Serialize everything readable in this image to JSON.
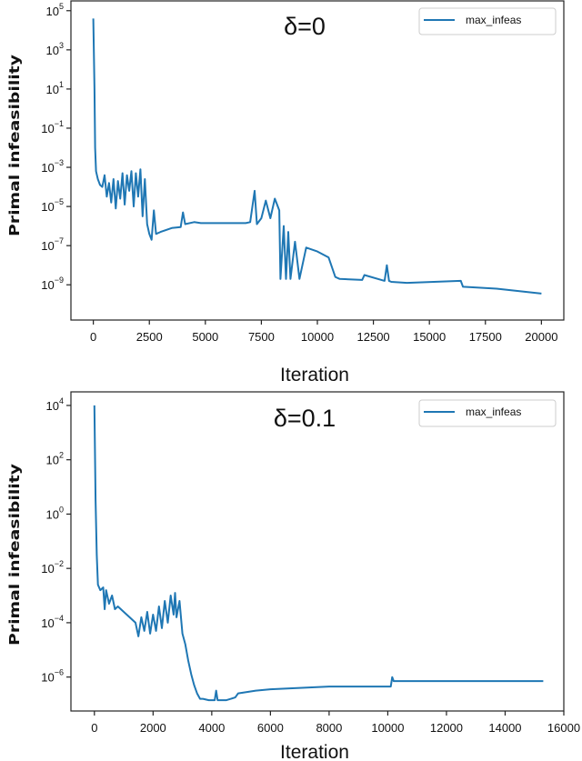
{
  "chart_data": [
    {
      "type": "line",
      "title": "δ=0",
      "xlabel": "Iteration",
      "ylabel": "Primal infeasibility",
      "yscale": "log",
      "xlim": [
        -1000,
        21000
      ],
      "ylim_exp": [
        -10.8,
        5.5
      ],
      "x_ticks": [
        0,
        2500,
        5000,
        7500,
        10000,
        12500,
        15000,
        17500,
        20000
      ],
      "x_tick_labels": [
        "0",
        "2500",
        "5000",
        "7500",
        "10000",
        "12500",
        "15000",
        "17500",
        "20000"
      ],
      "y_ticks_exp": [
        5,
        3,
        1,
        -1,
        -3,
        -5,
        -7,
        -9
      ],
      "y_tick_labels": [
        {
          "base": "10",
          "exp": "5"
        },
        {
          "base": "10",
          "exp": "3"
        },
        {
          "base": "10",
          "exp": "1"
        },
        {
          "base": "10",
          "exp": "−1"
        },
        {
          "base": "10",
          "exp": "−3"
        },
        {
          "base": "10",
          "exp": "−5"
        },
        {
          "base": "10",
          "exp": "−7"
        },
        {
          "base": "10",
          "exp": "−9"
        }
      ],
      "legend": {
        "position": "top-right",
        "entries": [
          {
            "label": "max_infeas",
            "color": "#1f77b4"
          }
        ]
      },
      "series": [
        {
          "name": "max_infeas",
          "color": "#1f77b4",
          "x": [
            0,
            50,
            80,
            120,
            200,
            300,
            400,
            500,
            600,
            700,
            800,
            900,
            1000,
            1100,
            1200,
            1300,
            1400,
            1500,
            1600,
            1700,
            1800,
            1900,
            2000,
            2100,
            2200,
            2300,
            2400,
            2500,
            2600,
            2700,
            2800,
            3000,
            3500,
            3900,
            4000,
            4100,
            4500,
            4800,
            5000,
            6000,
            6800,
            7000,
            7200,
            7300,
            7500,
            7700,
            7900,
            8100,
            8200,
            8300,
            8350,
            8500,
            8600,
            8700,
            8800,
            9000,
            9200,
            9500,
            10000,
            10500,
            10800,
            11000,
            12000,
            12100,
            13000,
            13100,
            13200,
            13300,
            14000,
            16400,
            16500,
            18000,
            20000
          ],
          "y_exp": [
            4.6,
            1.0,
            -2.0,
            -3.2,
            -3.6,
            -3.9,
            -4.0,
            -3.4,
            -4.5,
            -3.8,
            -4.8,
            -3.6,
            -5.1,
            -3.7,
            -4.6,
            -3.3,
            -4.9,
            -3.4,
            -4.2,
            -3.2,
            -5.0,
            -3.3,
            -4.5,
            -3.1,
            -5.5,
            -3.6,
            -5.9,
            -6.4,
            -6.7,
            -5.2,
            -6.4,
            -6.3,
            -6.1,
            -6.05,
            -5.3,
            -5.9,
            -5.8,
            -5.85,
            -5.85,
            -5.85,
            -5.85,
            -5.8,
            -4.2,
            -5.9,
            -5.6,
            -4.7,
            -5.6,
            -4.6,
            -4.9,
            -5.2,
            -8.7,
            -6.0,
            -8.7,
            -6.3,
            -8.7,
            -6.8,
            -8.7,
            -7.1,
            -7.3,
            -7.6,
            -8.6,
            -8.7,
            -8.75,
            -8.5,
            -8.8,
            -8.0,
            -8.8,
            -8.85,
            -8.9,
            -8.8,
            -9.1,
            -9.2,
            -9.45
          ]
        }
      ]
    },
    {
      "type": "line",
      "title": "δ=0.1",
      "xlabel": "Iteration",
      "ylabel": "Primal infeasibility",
      "yscale": "log",
      "xlim": [
        -800,
        16000
      ],
      "ylim_exp": [
        -7.25,
        4.5
      ],
      "x_ticks": [
        0,
        2000,
        4000,
        6000,
        8000,
        10000,
        12000,
        14000,
        16000
      ],
      "x_tick_labels": [
        "0",
        "2000",
        "4000",
        "6000",
        "8000",
        "10000",
        "12000",
        "14000",
        "16000"
      ],
      "y_ticks_exp": [
        4,
        2,
        0,
        -2,
        -4,
        -6
      ],
      "y_tick_labels": [
        {
          "base": "10",
          "exp": "4"
        },
        {
          "base": "10",
          "exp": "2"
        },
        {
          "base": "10",
          "exp": "0"
        },
        {
          "base": "10",
          "exp": "−2"
        },
        {
          "base": "10",
          "exp": "−4"
        },
        {
          "base": "10",
          "exp": "−6"
        }
      ],
      "legend": {
        "position": "top-right",
        "entries": [
          {
            "label": "max_infeas",
            "color": "#1f77b4"
          }
        ]
      },
      "series": [
        {
          "name": "max_infeas",
          "color": "#1f77b4",
          "x": [
            0,
            40,
            80,
            120,
            200,
            300,
            350,
            400,
            500,
            600,
            700,
            800,
            1000,
            1200,
            1400,
            1500,
            1600,
            1700,
            1800,
            1900,
            2000,
            2100,
            2200,
            2300,
            2400,
            2500,
            2600,
            2700,
            2750,
            2800,
            2900,
            3000,
            3100,
            3200,
            3300,
            3400,
            3500,
            3600,
            3700,
            3900,
            4100,
            4150,
            4200,
            4500,
            4800,
            4900,
            5200,
            5500,
            6000,
            7000,
            8000,
            9000,
            10100,
            10150,
            10200,
            11000,
            12000,
            13000,
            15300
          ],
          "y_exp": [
            4.0,
            0.5,
            -1.5,
            -2.6,
            -2.8,
            -2.7,
            -3.5,
            -2.8,
            -3.3,
            -3.0,
            -3.5,
            -3.4,
            -3.6,
            -3.8,
            -4.0,
            -4.5,
            -3.8,
            -4.3,
            -3.6,
            -4.4,
            -3.7,
            -4.3,
            -3.4,
            -4.2,
            -3.2,
            -4.0,
            -3.0,
            -3.7,
            -2.9,
            -3.8,
            -3.2,
            -4.4,
            -4.8,
            -5.4,
            -5.9,
            -6.3,
            -6.6,
            -6.8,
            -6.8,
            -6.85,
            -6.85,
            -6.5,
            -6.85,
            -6.85,
            -6.75,
            -6.6,
            -6.55,
            -6.5,
            -6.45,
            -6.4,
            -6.35,
            -6.35,
            -6.35,
            -6.0,
            -6.15,
            -6.15,
            -6.15,
            -6.15,
            -6.15
          ]
        }
      ]
    }
  ]
}
